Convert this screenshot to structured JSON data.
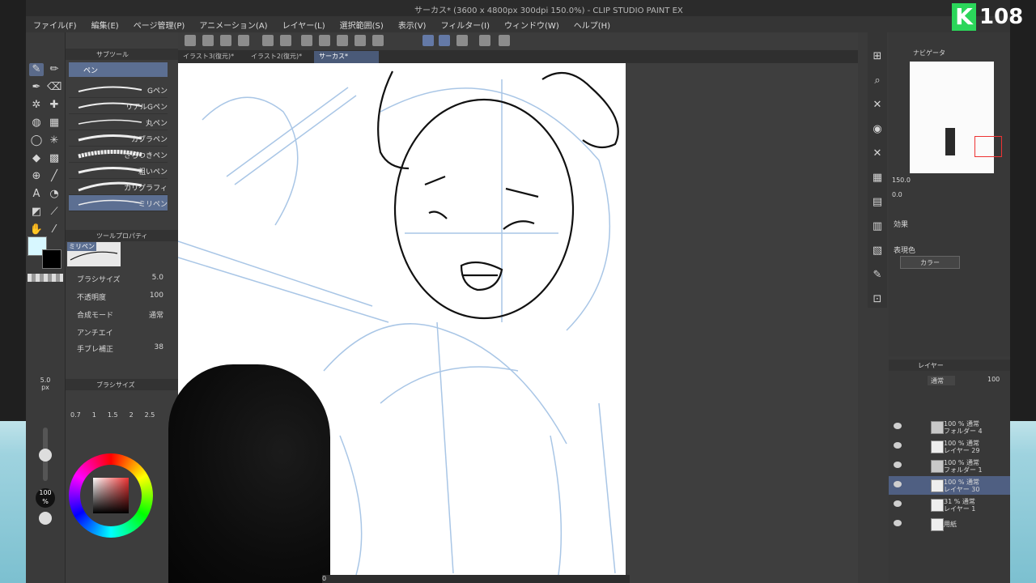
{
  "window": {
    "title": "サーカス* (3600 x 4800px 300dpi 150.0%) - CLIP STUDIO PAINT EX"
  },
  "menu": [
    "ファイル(F)",
    "編集(E)",
    "ページ管理(P)",
    "アニメーション(A)",
    "レイヤー(L)",
    "選択範囲(S)",
    "表示(V)",
    "フィルター(I)",
    "ウィンドウ(W)",
    "ヘルプ(H)"
  ],
  "tabs": [
    "イラスト3(復元)*",
    "イラスト2(復元)*",
    "サーカス*"
  ],
  "subtool": {
    "header": "サブツール",
    "group": "ペン",
    "brushes": [
      "Gペン",
      "リアルGペン",
      "丸ペン",
      "カブラペン",
      "さらつきペン",
      "粗いペン",
      "カリグラフィ",
      "ミリペン"
    ]
  },
  "tool_property": {
    "header": "ツールプロパティ",
    "current": "ミリペン",
    "brush_size_label": "ブラシサイズ",
    "brush_size": "5.0",
    "opacity_label": "不透明度",
    "opacity": "100",
    "blend_label": "合成モード",
    "blend": "通常",
    "antialias_label": "アンチエイ",
    "stabilization_label": "手ブレ補正",
    "stabilization": "38"
  },
  "brush_size_panel": {
    "header": "ブラシサイズ",
    "current": "5.0",
    "unit": "px",
    "presets": [
      "0.7",
      "1",
      "1.5",
      "2",
      "2.5"
    ]
  },
  "left_readouts": {
    "opacity": "100",
    "opacity_unit": "%"
  },
  "navigator": {
    "header": "ナビゲータ",
    "zoom": "150.0",
    "rotation": "0.0"
  },
  "sub_view": {
    "effect_label": "効果",
    "expression_label": "表現色",
    "expression_value": "カラー"
  },
  "layers": {
    "header": "レイヤー",
    "blend": "通常",
    "opacity": "100",
    "items": [
      {
        "line1": "100 % 通常",
        "line2": "フォルダー 4"
      },
      {
        "line1": "100 % 通常",
        "line2": "レイヤー 29"
      },
      {
        "line1": "100 % 通常",
        "line2": "フォルダー 1"
      },
      {
        "line1": "100 % 通常",
        "line2": "レイヤー 30"
      },
      {
        "line1": "31 % 通常",
        "line2": "レイヤー 1"
      },
      {
        "line1": "用紙",
        "line2": ""
      }
    ]
  },
  "canvas_footer": {
    "value": "0"
  },
  "overlay": {
    "logo_letter": "K",
    "logo_number": "108"
  },
  "colors": {
    "accent": "#4f5f82",
    "panel": "#3a3a3a",
    "canvas_bg": "#3e3e3e",
    "sketch_blue": "#a9c6e6"
  }
}
